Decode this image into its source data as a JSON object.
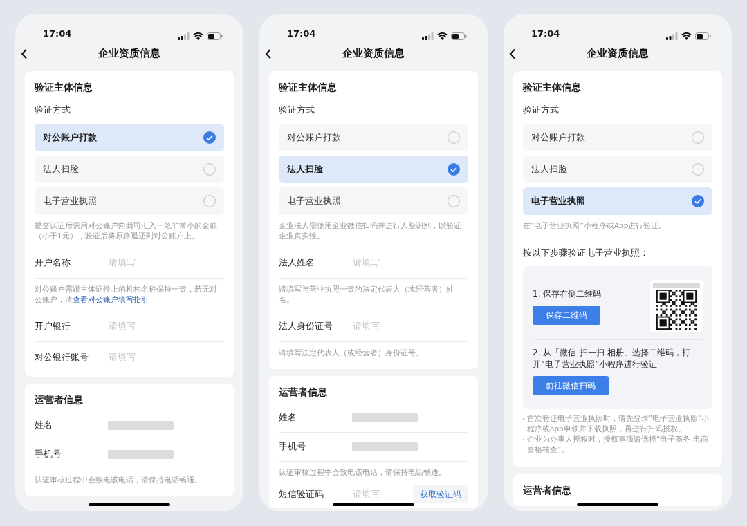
{
  "phones": [
    {
      "time": "17:04",
      "title": "企业资质信息",
      "cards": [
        {
          "items": [
            {
              "kind": "heading",
              "text": "验证主体信息"
            },
            {
              "kind": "subheading",
              "text": "验证方式"
            },
            {
              "kind": "options",
              "options": [
                {
                  "label": "对公账户打款",
                  "selected": true
                },
                {
                  "label": "法人扫脸",
                  "selected": false
                },
                {
                  "label": "电子营业执照",
                  "selected": false
                }
              ]
            },
            {
              "kind": "note",
              "text": "提交认证后需用对公账户向我司汇入一笔非常小的金额（小于1元），验证后将原路退还到对公账户上。"
            },
            {
              "kind": "field",
              "label": "开户名称",
              "placeholder": "请填写",
              "divider": true
            },
            {
              "kind": "note",
              "text": "对公账户需跟主体证件上的机构名称保持一致，若无对公账户，请",
              "link": "查看对公账户填写指引"
            },
            {
              "kind": "field",
              "label": "开户银行",
              "placeholder": "请填写",
              "divider": true
            },
            {
              "kind": "field",
              "label": "对公银行账号",
              "placeholder": "请填写",
              "divider": false
            }
          ]
        },
        {
          "items": [
            {
              "kind": "heading",
              "text": "运营者信息"
            },
            {
              "kind": "masked",
              "label": "姓名",
              "divider": true
            },
            {
              "kind": "masked",
              "label": "手机号",
              "divider": true
            },
            {
              "kind": "note",
              "text": "认证审核过程中会致电该电话，请保持电话畅通。"
            }
          ]
        }
      ]
    },
    {
      "time": "17:04",
      "title": "企业资质信息",
      "cards": [
        {
          "items": [
            {
              "kind": "heading",
              "text": "验证主体信息"
            },
            {
              "kind": "subheading",
              "text": "验证方式"
            },
            {
              "kind": "options",
              "options": [
                {
                  "label": "对公账户打款",
                  "selected": false
                },
                {
                  "label": "法人扫脸",
                  "selected": true
                },
                {
                  "label": "电子营业执照",
                  "selected": false
                }
              ]
            },
            {
              "kind": "note",
              "text": "企业法人需使用企业微信扫码并进行人脸识别，以验证企业真实性。"
            },
            {
              "kind": "field",
              "label": "法人姓名",
              "placeholder": "请填写",
              "divider": true
            },
            {
              "kind": "note",
              "text": "请填写与营业执照一致的法定代表人（或经营者）姓名。"
            },
            {
              "kind": "field",
              "label": "法人身份证号",
              "placeholder": "请填写",
              "divider": true
            },
            {
              "kind": "note",
              "text": "请填写法定代表人（或经营者）身份证号。"
            }
          ]
        },
        {
          "items": [
            {
              "kind": "heading",
              "text": "运营者信息"
            },
            {
              "kind": "masked",
              "label": "姓名",
              "divider": true
            },
            {
              "kind": "masked",
              "label": "手机号",
              "divider": true
            },
            {
              "kind": "note",
              "text": "认证审核过程中会致电该电话，请保持电话畅通。"
            },
            {
              "kind": "sms",
              "label": "短信验证码",
              "placeholder": "请填写",
              "button": "获取验证码"
            }
          ]
        }
      ]
    },
    {
      "time": "17:04",
      "title": "企业资质信息",
      "cards": [
        {
          "items": [
            {
              "kind": "heading",
              "text": "验证主体信息"
            },
            {
              "kind": "subheading",
              "text": "验证方式"
            },
            {
              "kind": "options",
              "options": [
                {
                  "label": "对公账户打款",
                  "selected": false
                },
                {
                  "label": "法人扫脸",
                  "selected": false
                },
                {
                  "label": "电子营业执照",
                  "selected": true
                }
              ]
            },
            {
              "kind": "note",
              "text": "在“电子营业执照”小程序或App进行验证。"
            },
            {
              "kind": "instruction",
              "text": "按以下步骤验证电子营业执照："
            },
            {
              "kind": "steps",
              "steps": [
                {
                  "text": "1. 保存右侧二维码",
                  "button": "保存二维码",
                  "qr": true
                },
                {
                  "text": "2. 从「微信-扫一扫-相册」选择二维码，打开“电子营业执照”小程序进行验证",
                  "button": "前往微信扫码",
                  "qr": false
                }
              ]
            },
            {
              "kind": "bullets",
              "bullets": [
                "首次验证电子营业执照时，请先登录\"电子营业执照\"小程序或app申领并下载执照，再进行扫码授权。",
                "企业为办事人授权时，授权事项请选择“电子商务-电商-资格核查”。"
              ]
            }
          ]
        },
        {
          "items": [
            {
              "kind": "heading",
              "text": "运营者信息"
            }
          ]
        }
      ]
    }
  ]
}
